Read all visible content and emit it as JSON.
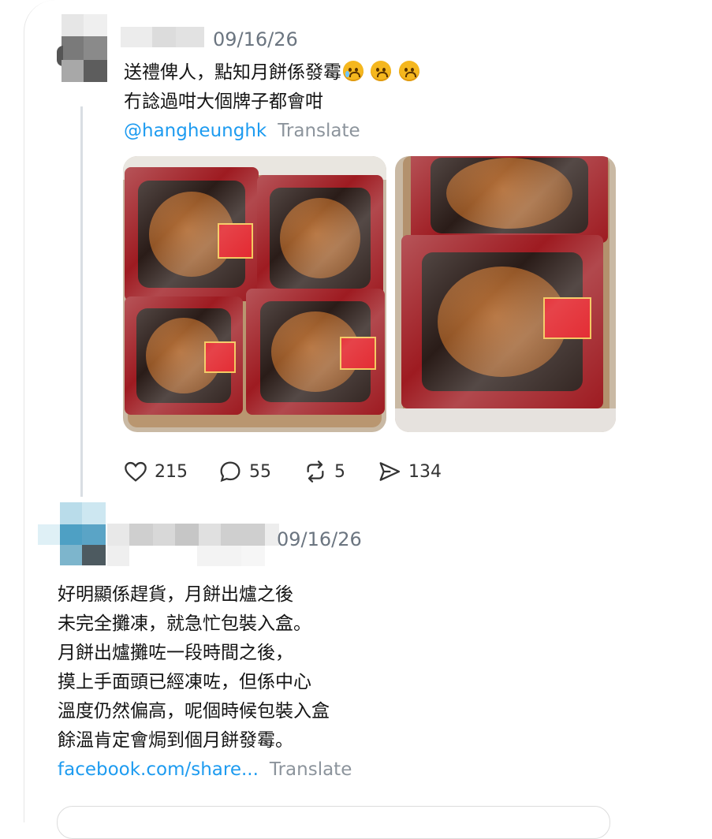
{
  "post1": {
    "date": "09/16/26",
    "line1": "送禮俾人，點知月餅係發霉",
    "line2": "冇諗過咁大個牌子都會咁",
    "mention": "@hangheunghk",
    "translate": "Translate",
    "emoji_icons": [
      "crying-face-icon",
      "sad-face-icon",
      "sad-face-icon"
    ],
    "stats": {
      "likes": "215",
      "replies": "55",
      "reposts": "5",
      "shares": "134"
    }
  },
  "post2": {
    "date": "09/16/26",
    "lines": [
      "好明顯係趕貨，月餅出爐之後",
      "未完全攤凍，就急忙包裝入盒。",
      "月餅出爐攤咗一段時間之後，",
      "摸上手面頭已經凍咗，但係中心",
      "溫度仍然偏高，呢個時候包裝入盒",
      "餘溫肯定會焗到個月餅發霉。"
    ],
    "link": "facebook.com/share...",
    "translate": "Translate"
  },
  "colors": {
    "link": "#1d9bf0",
    "thread_line": "#d9dee3",
    "muted": "#6b7580"
  }
}
